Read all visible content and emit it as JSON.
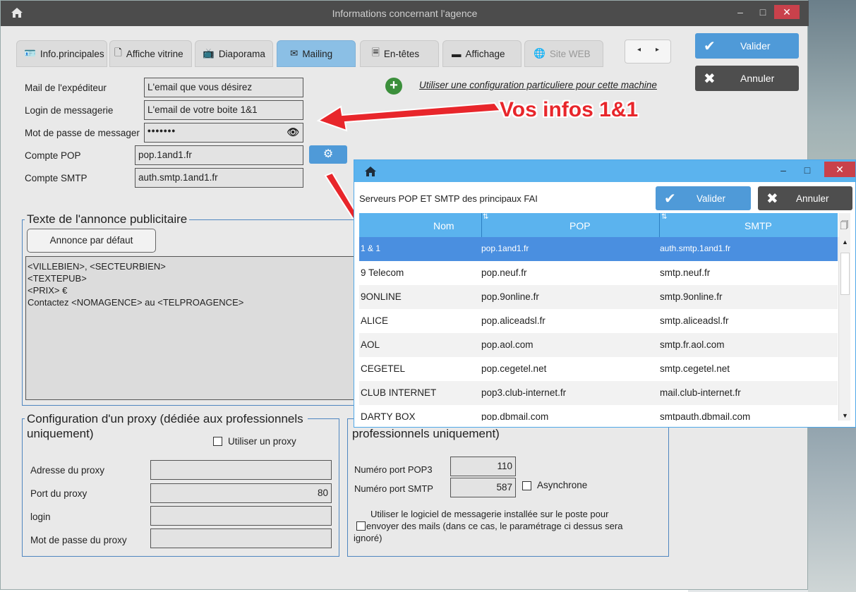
{
  "window": {
    "title": "Informations concernant l'agence",
    "controls": {
      "minimize": "–",
      "maximize": "□",
      "close": "✕"
    }
  },
  "tabs": [
    {
      "label": "Info.principales",
      "icon": "id-card-icon",
      "glyph": "🪪"
    },
    {
      "label": "Affiche vitrine",
      "icon": "document-icon",
      "glyph": "🗋"
    },
    {
      "label": "Diaporama",
      "icon": "tv-icon",
      "glyph": "📺"
    },
    {
      "label": "Mailing",
      "icon": "envelope-icon",
      "glyph": "✉",
      "active": true
    },
    {
      "label": "En-têtes",
      "icon": "header-doc-icon",
      "glyph": "🗏"
    },
    {
      "label": "Affichage",
      "icon": "monitor-icon",
      "glyph": "▬"
    },
    {
      "label": "Site WEB",
      "icon": "globe-icon",
      "glyph": "🌐",
      "disabled": true
    }
  ],
  "nav": {
    "prev": "◂",
    "next": "▸"
  },
  "side_buttons": {
    "valider": "Valider",
    "annuler": "Annuler"
  },
  "form": {
    "sender_label": "Mail de l'expéditeur",
    "sender_value": "L'email que vous désirez",
    "login_label": "Login de messagerie",
    "login_value": "L'email de votre boite 1&1",
    "password_label": "Mot de passe de messager",
    "password_value": "•••••••",
    "pop_label": "Compte POP",
    "pop_value": "pop.1and1.fr",
    "smtp_label": "Compte SMTP",
    "smtp_value": "auth.smtp.1and1.fr"
  },
  "add_config_text": "Utiliser une configuration particuliere pour cette machine",
  "annotation": "Vos infos 1&1",
  "ad_section": {
    "legend": "Texte de l'annonce publicitaire",
    "default_button": "Annonce par défaut",
    "lines": [
      "<VILLEBIEN>, <SECTEURBIEN>",
      "<TEXTEPUB>",
      "<PRIX> €",
      "Contactez <NOMAGENCE> au <TELPROAGENCE>"
    ]
  },
  "proxy_section": {
    "legend_line1": "Configuration d'un proxy (dédiée aux professionnels",
    "legend_line2": "uniquement)",
    "use_proxy": "Utiliser un proxy",
    "address_label": "Adresse du proxy",
    "address_value": "",
    "port_label": "Port du proxy",
    "port_value": "80",
    "login_label": "login",
    "login_value": "",
    "password_label": "Mot de passe du proxy",
    "password_value": ""
  },
  "ports_section": {
    "legend_tail": "professionnels uniquement)",
    "pop3_label": "Numéro port POP3",
    "pop3_value": "110",
    "smtp_label": "Numéro port SMTP",
    "smtp_value": "587",
    "async_label": "Asynchrone",
    "mail_client_line1": "Utiliser le logiciel de messagerie installée sur le poste pour",
    "mail_client_line2": "envoyer des mails (dans ce cas, le paramétrage ci dessus sera",
    "mail_client_line3": "ignoré)"
  },
  "popup": {
    "header": "Serveurs POP ET SMTP des principaux FAI",
    "valider": "Valider",
    "annuler": "Annuler",
    "columns": [
      "Nom",
      "POP",
      "SMTP"
    ],
    "rows": [
      {
        "nom": "1 & 1",
        "pop": "pop.1and1.fr",
        "smtp": "auth.smtp.1and1.fr"
      },
      {
        "nom": "9 Telecom",
        "pop": "pop.neuf.fr",
        "smtp": "smtp.neuf.fr"
      },
      {
        "nom": "9ONLINE",
        "pop": "pop.9online.fr",
        "smtp": "smtp.9online.fr"
      },
      {
        "nom": "ALICE",
        "pop": "pop.aliceadsl.fr",
        "smtp": "smtp.aliceadsl.fr"
      },
      {
        "nom": "AOL",
        "pop": "pop.aol.com",
        "smtp": "smtp.fr.aol.com"
      },
      {
        "nom": "CEGETEL",
        "pop": "pop.cegetel.net",
        "smtp": "smtp.cegetel.net"
      },
      {
        "nom": "CLUB INTERNET",
        "pop": "pop3.club-internet.fr",
        "smtp": "mail.club-internet.fr"
      },
      {
        "nom": "DARTY BOX",
        "pop": "pop.dbmail.com",
        "smtp": "smtpauth.dbmail.com"
      }
    ]
  },
  "colors": {
    "accent_blue": "#4f9ad8",
    "popup_blue": "#5bb3ee",
    "selected_row": "#4a8fe0",
    "annotation_red": "#e8262b",
    "dark_button": "#4e4e4e",
    "close_red": "#c9414b"
  }
}
